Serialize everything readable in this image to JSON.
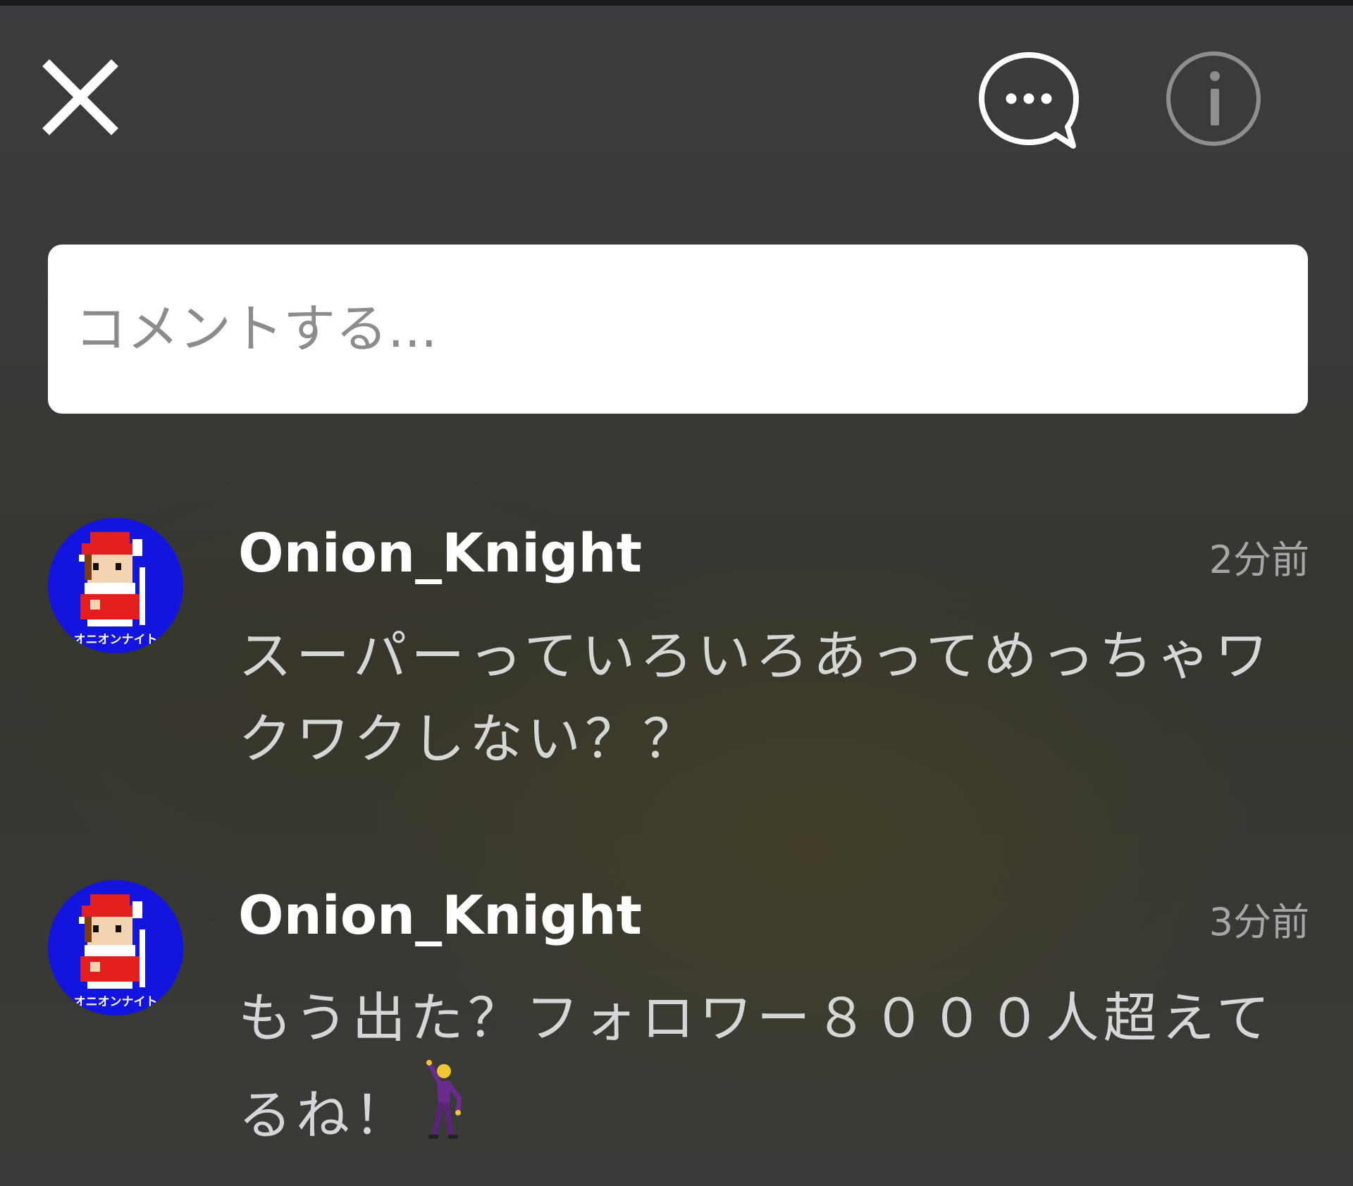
{
  "header": {
    "close_icon": "close-icon",
    "chat_icon": "chat-bubble-more-icon",
    "info_icon": "info-icon"
  },
  "comment_box": {
    "placeholder": "コメントする..."
  },
  "comments": [
    {
      "username": "Onion_Knight",
      "timestamp": "2分前",
      "text": "スーパーっていろいろあってめっちゃワクワクしない？？",
      "avatar_caption": "オニオンナイト"
    },
    {
      "username": "Onion_Knight",
      "timestamp": "3分前",
      "text": "もう出た？フォロワー８０００人超えてるね！",
      "emoji": "dancer-icon",
      "avatar_caption": "オニオンナイト"
    }
  ],
  "colors": {
    "background": "#3a3a3d",
    "input_background": "#ffffff",
    "username": "#ffffff",
    "body_text": "#d6d6d6",
    "timestamp": "#a6a6a6",
    "avatar_bg": "#1414e0"
  }
}
